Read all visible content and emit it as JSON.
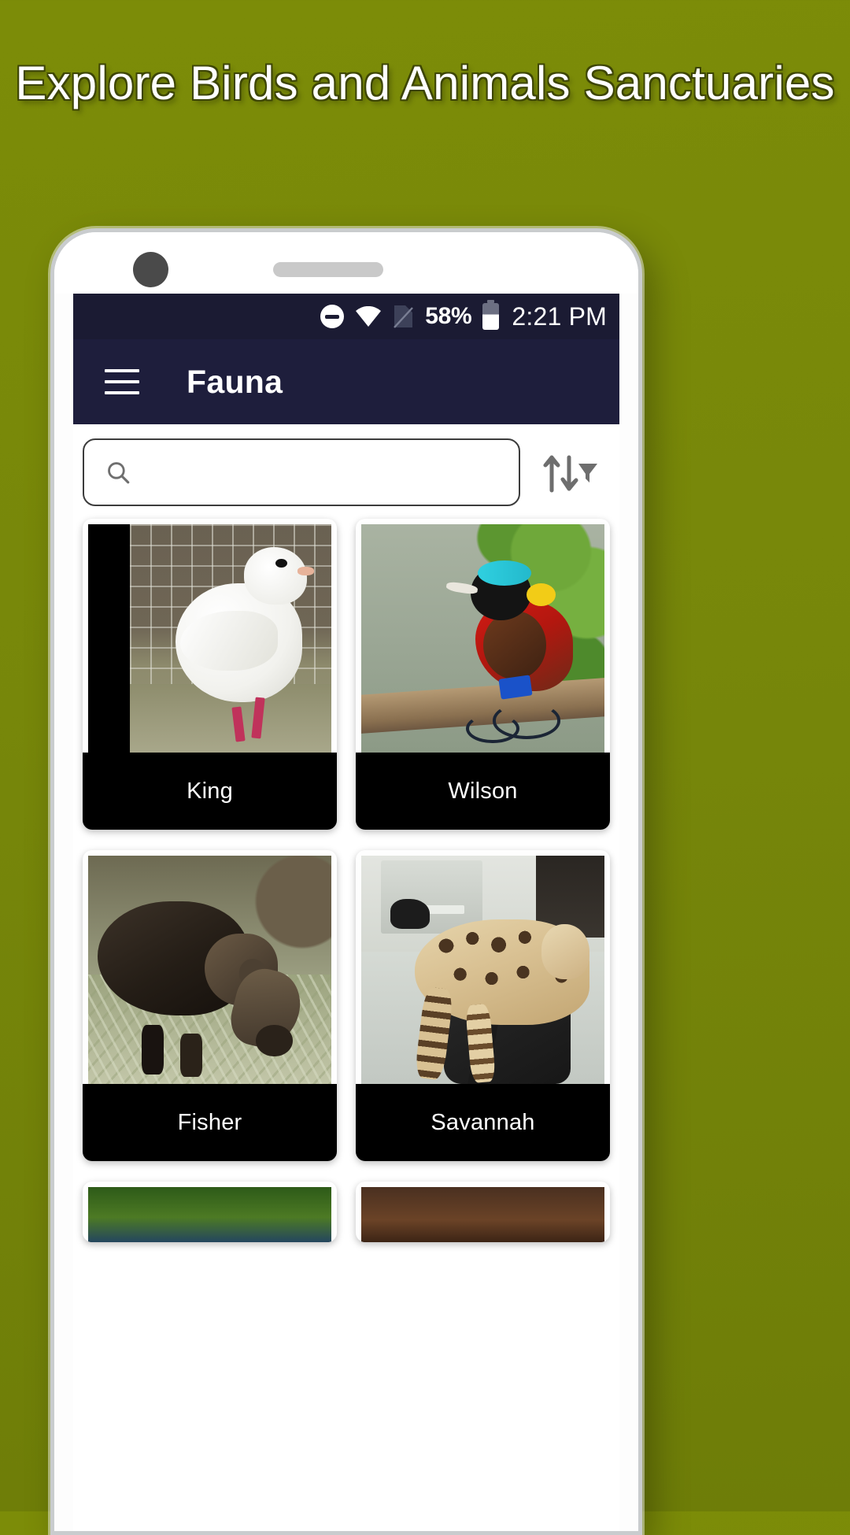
{
  "page": {
    "headline": "Explore Birds and Animals Sanctuaries",
    "background_color": "#77880a",
    "headline_color": "#ffffff"
  },
  "statusbar": {
    "dnd_icon": "do-not-disturb-icon",
    "wifi_icon": "wifi-icon",
    "signal_icon": "no-sim-icon",
    "battery_percent": "58%",
    "battery_icon": "battery-icon",
    "time": "2:21 PM",
    "background_color": "#1b1b33"
  },
  "appbar": {
    "menu_icon": "hamburger-menu-icon",
    "title": "Fauna",
    "background_color": "#1e1e3c",
    "text_color": "#ffffff"
  },
  "search": {
    "icon": "search-icon",
    "value": "",
    "placeholder": "",
    "sort_icon": "sort-filter-icon"
  },
  "grid": {
    "cards": [
      {
        "label": "King",
        "image": "white-king-pigeon-in-wire-cage"
      },
      {
        "label": "Wilson",
        "image": "wilsons-bird-of-paradise-on-branch"
      },
      {
        "label": "Fisher",
        "image": "fisher-marten-foraging-on-moss"
      },
      {
        "label": "Savannah",
        "image": "savannah-cat-on-office-chair"
      }
    ],
    "partial_row": [
      {
        "image": "green-foliage-thumbnail"
      },
      {
        "image": "brown-animal-thumbnail"
      }
    ],
    "label_background": "#000000",
    "label_color": "#ffffff"
  }
}
